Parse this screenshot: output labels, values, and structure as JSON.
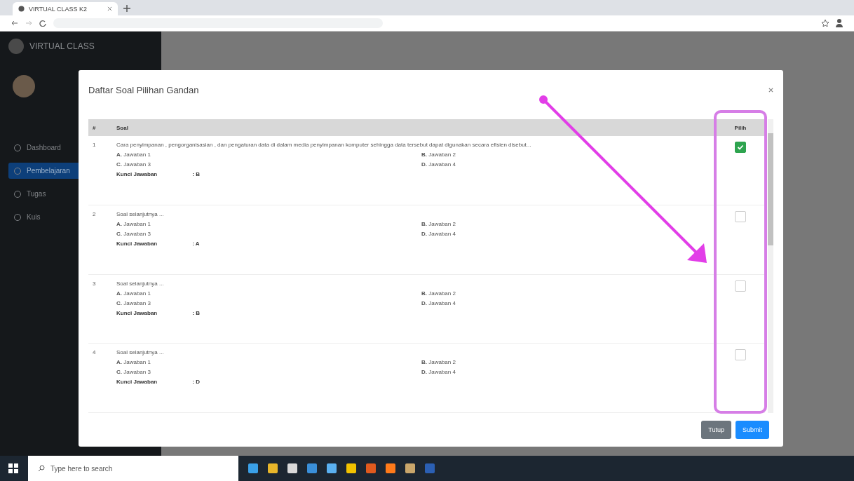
{
  "browser": {
    "tab_title": "VIRTUAL CLASS K2"
  },
  "sidebar": {
    "brand": "VIRTUAL CLASS",
    "items": [
      {
        "label": "Dashboard",
        "selected": false
      },
      {
        "label": "Pembelajaran",
        "selected": true
      },
      {
        "label": "Tugas",
        "selected": false
      },
      {
        "label": "Kuis",
        "selected": false
      }
    ]
  },
  "modal": {
    "title": "Daftar Soal Pilihan Gandan",
    "columns": [
      "#",
      "Soal",
      "Pilih"
    ],
    "rows": [
      {
        "number": "1",
        "question": "Cara penyimpanan , pengorganisasian , dan pengaturan data di dalam media penyimpanan komputer sehingga data tersebut dapat digunakan secara efisien disebut...",
        "options": [
          {
            "letter": "A.",
            "text": "Jawaban 1"
          },
          {
            "letter": "B.",
            "text": "Jawaban 2"
          },
          {
            "letter": "C.",
            "text": "Jawaban 3"
          },
          {
            "letter": "D.",
            "text": "Jawaban 4"
          }
        ],
        "key_label": "Kunci Jawaban",
        "key_value": ": B",
        "checked": true
      },
      {
        "number": "2",
        "question": "Soal selanjutnya ...",
        "options": [
          {
            "letter": "A.",
            "text": "Jawaban 1"
          },
          {
            "letter": "B.",
            "text": "Jawaban 2"
          },
          {
            "letter": "C.",
            "text": "Jawaban 3"
          },
          {
            "letter": "D.",
            "text": "Jawaban 4"
          }
        ],
        "key_label": "Kunci Jawaban",
        "key_value": ": A",
        "checked": false
      },
      {
        "number": "3",
        "question": "Soal selanjutnya ...",
        "options": [
          {
            "letter": "A.",
            "text": "Jawaban 1"
          },
          {
            "letter": "B.",
            "text": "Jawaban 2"
          },
          {
            "letter": "C.",
            "text": "Jawaban 3"
          },
          {
            "letter": "D.",
            "text": "Jawaban 4"
          }
        ],
        "key_label": "Kunci Jawaban",
        "key_value": ": B",
        "checked": false
      },
      {
        "number": "4",
        "question": "Soal selanjutnya ...",
        "options": [
          {
            "letter": "A.",
            "text": "Jawaban 1"
          },
          {
            "letter": "B.",
            "text": "Jawaban 2"
          },
          {
            "letter": "C.",
            "text": "Jawaban 3"
          },
          {
            "letter": "D.",
            "text": "Jawaban 4"
          }
        ],
        "key_label": "Kunci Jawaban",
        "key_value": ": D",
        "checked": false
      }
    ],
    "buttons": [
      {
        "label": "Tutup",
        "kind": "secondary"
      },
      {
        "label": "Submit",
        "kind": "primary"
      }
    ]
  },
  "taskbar": {
    "search_placeholder": "Type here to search"
  }
}
